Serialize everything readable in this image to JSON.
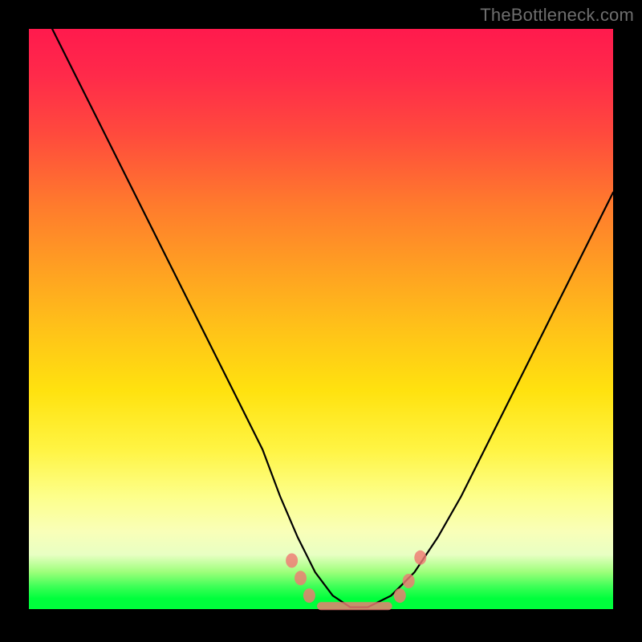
{
  "watermark": "TheBottleneck.com",
  "colors": {
    "marker": "#ef7a74",
    "curve": "#000000",
    "frame": "#000000"
  },
  "chart_data": {
    "type": "line",
    "title": "",
    "xlabel": "",
    "ylabel": "",
    "xlim": [
      0,
      100
    ],
    "ylim": [
      0,
      100
    ],
    "grid": false,
    "legend": false,
    "series": [
      {
        "name": "bottleneck-curve",
        "x": [
          0,
          4,
          8,
          12,
          16,
          20,
          24,
          28,
          32,
          36,
          40,
          43,
          46,
          49,
          52,
          55,
          58,
          62,
          66,
          70,
          74,
          78,
          82,
          86,
          90,
          94,
          98,
          100
        ],
        "y": [
          108,
          100,
          92,
          84,
          76,
          68,
          60,
          52,
          44,
          36,
          28,
          20,
          13,
          7,
          3,
          1,
          1,
          3,
          7,
          13,
          20,
          28,
          36,
          44,
          52,
          60,
          68,
          72
        ]
      }
    ],
    "markers": {
      "name": "highlight-dots",
      "points": [
        {
          "x": 45.0,
          "y": 9.0
        },
        {
          "x": 46.5,
          "y": 6.0
        },
        {
          "x": 48.0,
          "y": 3.0
        },
        {
          "x": 63.5,
          "y": 3.0
        },
        {
          "x": 65.0,
          "y": 5.5
        },
        {
          "x": 67.0,
          "y": 9.5
        }
      ],
      "bottom_segment": {
        "x0": 50.0,
        "x1": 61.5,
        "y": 1.2
      }
    }
  }
}
